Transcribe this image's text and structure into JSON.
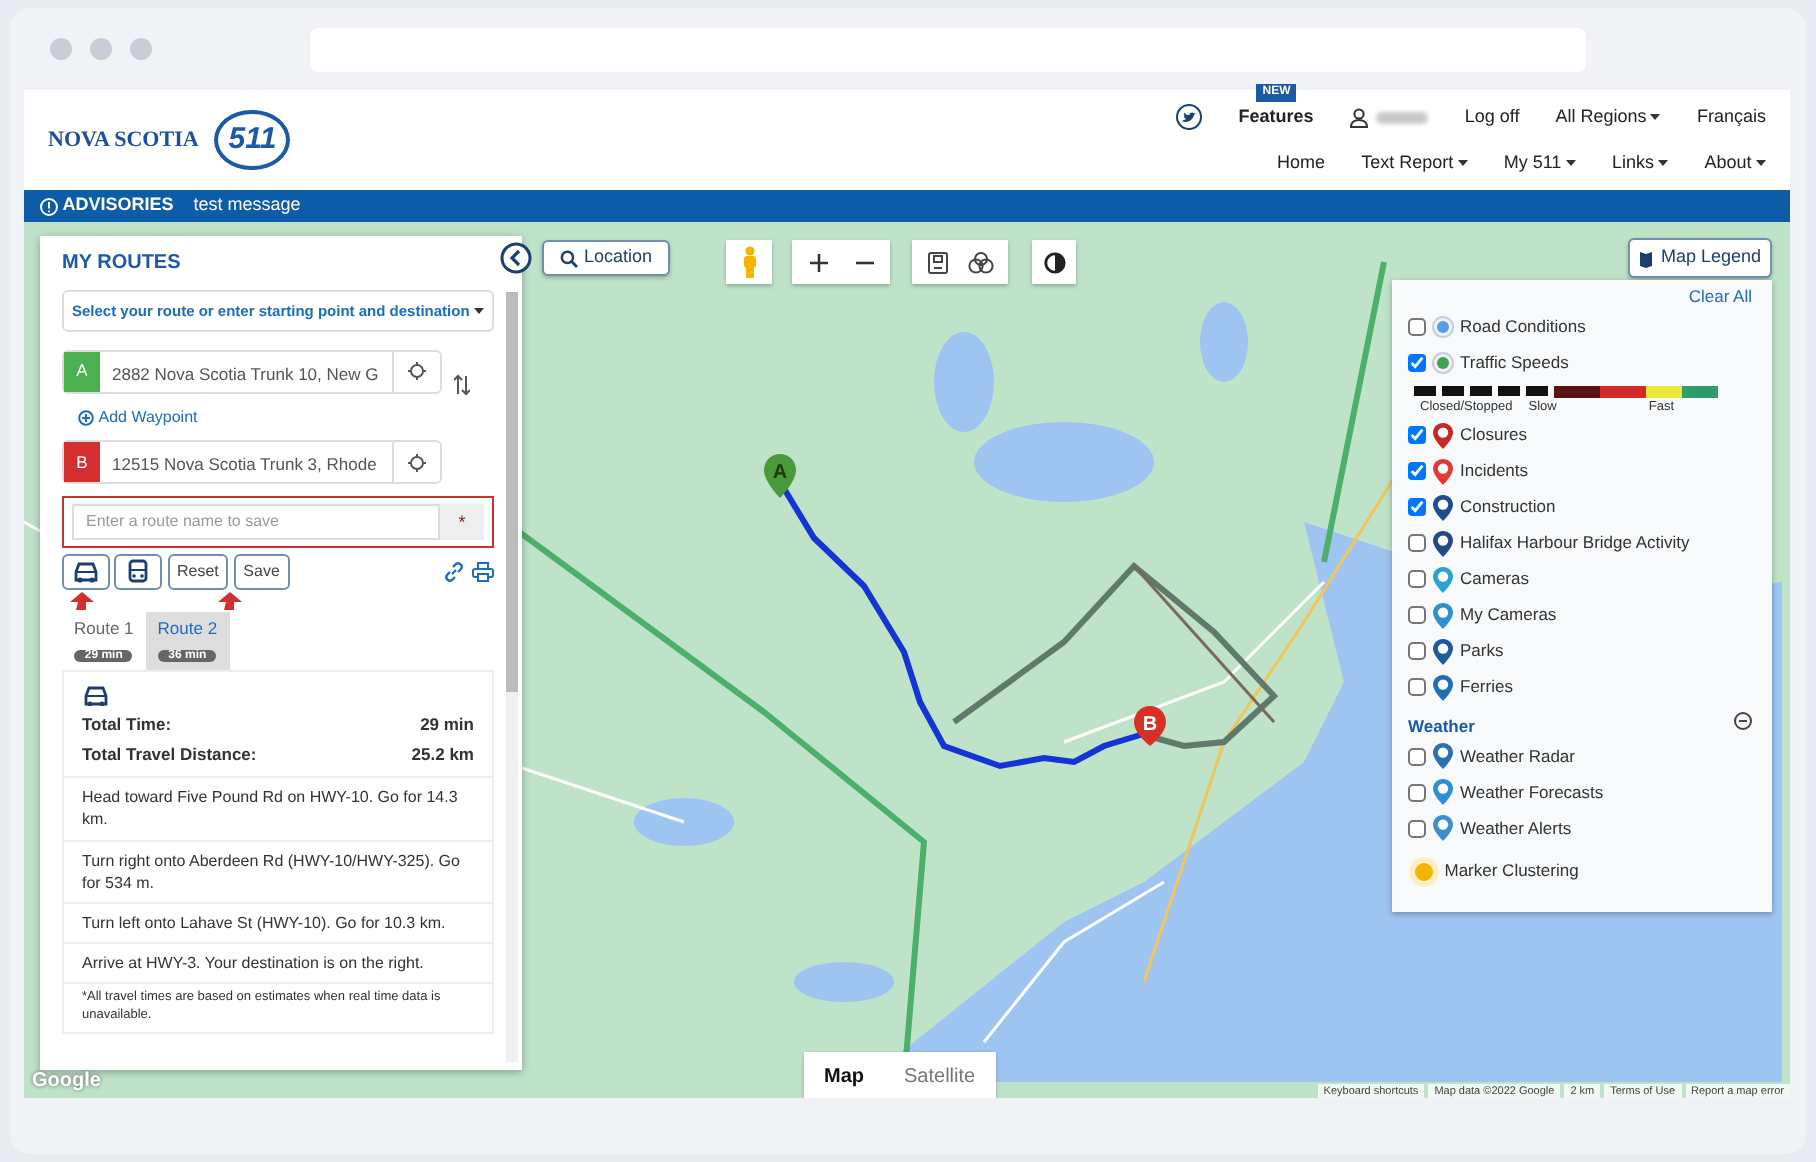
{
  "map_markers": [
    "A",
    "B"
  ],
  "logo": {
    "province": "NOVA SCOTIA",
    "number": "511"
  },
  "header": {
    "new_badge": "NEW",
    "features": "Features",
    "logoff": "Log off",
    "regions": "All Regions",
    "language": "Français",
    "nav": [
      {
        "label": "Home",
        "dropdown": false
      },
      {
        "label": "Text Report",
        "dropdown": true
      },
      {
        "label": "My 511",
        "dropdown": true
      },
      {
        "label": "Links",
        "dropdown": true
      },
      {
        "label": "About",
        "dropdown": true
      }
    ]
  },
  "advisory": {
    "label": "ADVISORIES",
    "message": "test message"
  },
  "routes_panel": {
    "title": "MY ROUTES",
    "select": "Select your route or enter starting point and destination",
    "origin": {
      "marker": "A",
      "value": "2882 Nova Scotia Trunk 10, New G"
    },
    "add_waypoint": "Add Waypoint",
    "destination": {
      "marker": "B",
      "value": "12515 Nova Scotia Trunk 3, Rhode"
    },
    "name_placeholder": "Enter a route name to save",
    "required_mark": "*",
    "modes": [
      {
        "kind": "car"
      },
      {
        "kind": "bus"
      }
    ],
    "buttons": [
      "Reset",
      "Save"
    ],
    "tabs": [
      {
        "label": "Route 1",
        "time": "29 min",
        "selected": true
      },
      {
        "label": "Route 2",
        "time": "36 min",
        "selected": false
      }
    ],
    "summary": [
      {
        "label": "Total Time:",
        "value": "29 min"
      },
      {
        "label": "Total Travel Distance:",
        "value": "25.2 km"
      }
    ],
    "steps": [
      "Head toward Five Pound Rd on HWY-10. Go for 14.3 km.",
      "Turn right onto Aberdeen Rd (HWY-10/HWY-325). Go for 534 m.",
      "Turn left onto Lahave St (HWY-10). Go for 10.3 km.",
      "Arrive at HWY-3. Your destination is on the right."
    ],
    "footnote": "*All travel times are based on estimates when real time data is unavailable."
  },
  "map_toolbar": {
    "location": "Location"
  },
  "legend": {
    "button": "Map Legend",
    "clear_all": "Clear All",
    "layers": [
      {
        "label": "Road Conditions",
        "checked": false,
        "kind": "circle",
        "color": "#5a9be6"
      },
      {
        "label": "Traffic Speeds",
        "checked": true,
        "kind": "circle",
        "color": "#3fa34d"
      },
      {
        "label": "Closures",
        "checked": true,
        "kind": "pin",
        "color": "#c62828"
      },
      {
        "label": "Incidents",
        "checked": true,
        "kind": "pin",
        "color": "#e53935"
      },
      {
        "label": "Construction",
        "checked": true,
        "kind": "pin",
        "color": "#1f4e8c"
      },
      {
        "label": "Halifax Harbour Bridge Activity",
        "checked": false,
        "kind": "pin",
        "color": "#234a86"
      },
      {
        "label": "Cameras",
        "checked": false,
        "kind": "pin",
        "color": "#29a3d6"
      },
      {
        "label": "My Cameras",
        "checked": false,
        "kind": "pin",
        "color": "#2b8fd0"
      },
      {
        "label": "Parks",
        "checked": false,
        "kind": "pin",
        "color": "#1e5aa0"
      },
      {
        "label": "Ferries",
        "checked": false,
        "kind": "pin",
        "color": "#1f6fb8"
      }
    ],
    "speed_labels": [
      "Closed/Stopped",
      "Slow",
      "Fast"
    ],
    "weather_title": "Weather",
    "weather_layers": [
      {
        "label": "Weather Radar",
        "checked": false,
        "color": "#2d6fb0"
      },
      {
        "label": "Weather Forecasts",
        "checked": false,
        "color": "#2a8fd6"
      },
      {
        "label": "Weather Alerts",
        "checked": false,
        "color": "#3b8fd0"
      }
    ],
    "clustering": "Marker Clustering"
  },
  "map_type": [
    {
      "label": "Map",
      "selected": true
    },
    {
      "label": "Satellite",
      "selected": false
    }
  ],
  "attribution": [
    "Keyboard shortcuts",
    "Map data ©2022 Google",
    "2 km",
    "Terms of Use",
    "Report a map error"
  ],
  "google_logo": "Google"
}
